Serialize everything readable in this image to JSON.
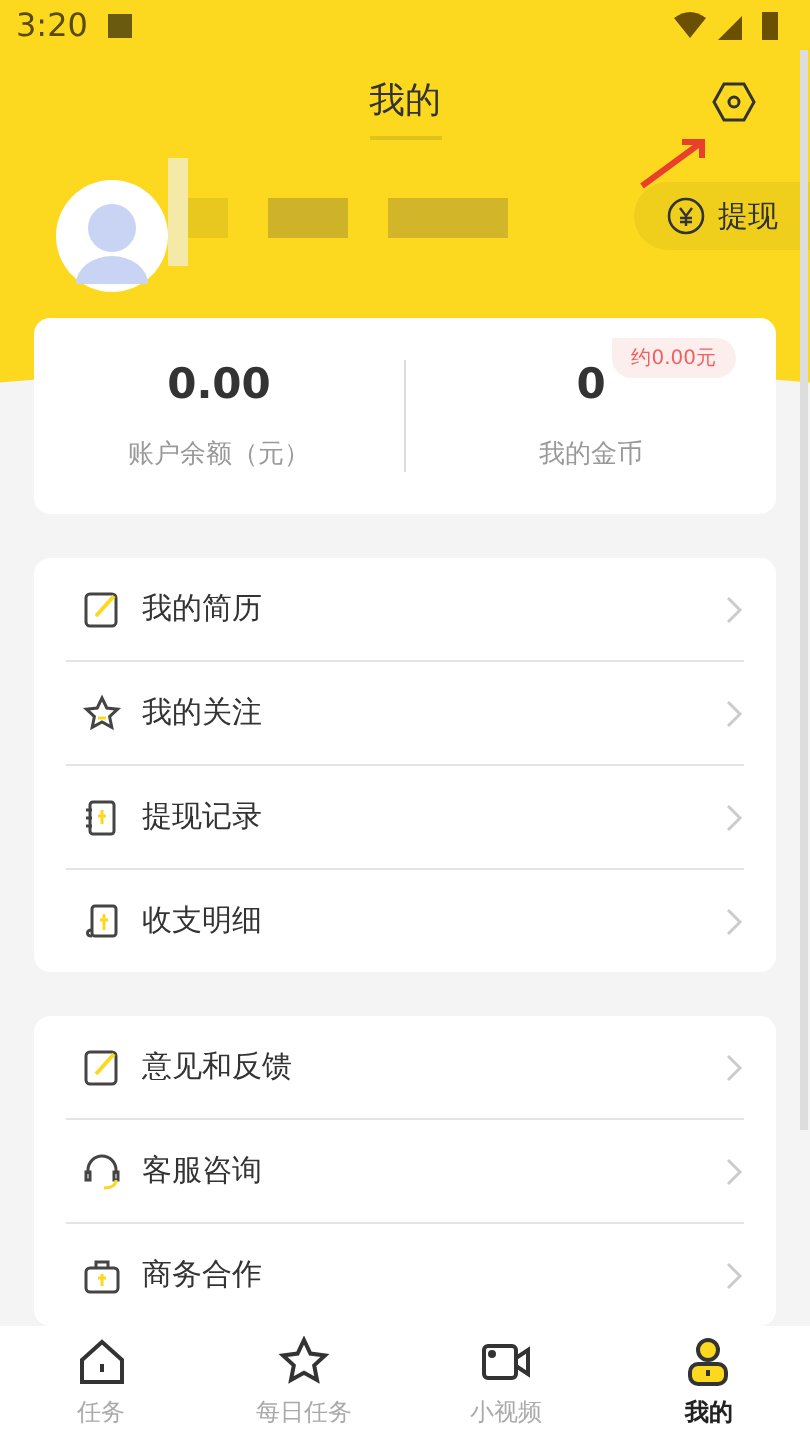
{
  "status_bar": {
    "time": "3:20"
  },
  "header": {
    "title": "我的",
    "withdraw_button": "提现"
  },
  "stats": [
    {
      "value": "0.00",
      "label": "账户余额（元）"
    },
    {
      "value": "0",
      "label": "我的金币",
      "badge": "约0.00元"
    }
  ],
  "menu_groups": [
    [
      {
        "label": "我的简历",
        "kind": "edit"
      },
      {
        "label": "我的关注",
        "kind": "star"
      },
      {
        "label": "提现记录",
        "kind": "book"
      },
      {
        "label": "收支明细",
        "kind": "receipt"
      }
    ],
    [
      {
        "label": "意见和反馈",
        "kind": "edit"
      },
      {
        "label": "客服咨询",
        "kind": "headset"
      },
      {
        "label": "商务合作",
        "kind": "bag"
      }
    ]
  ],
  "tabs": [
    {
      "label": "任务",
      "kind": "home",
      "selected": false
    },
    {
      "label": "每日任务",
      "kind": "star",
      "selected": false
    },
    {
      "label": "小视频",
      "kind": "video",
      "selected": false
    },
    {
      "label": "我的",
      "kind": "user",
      "selected": true
    }
  ]
}
